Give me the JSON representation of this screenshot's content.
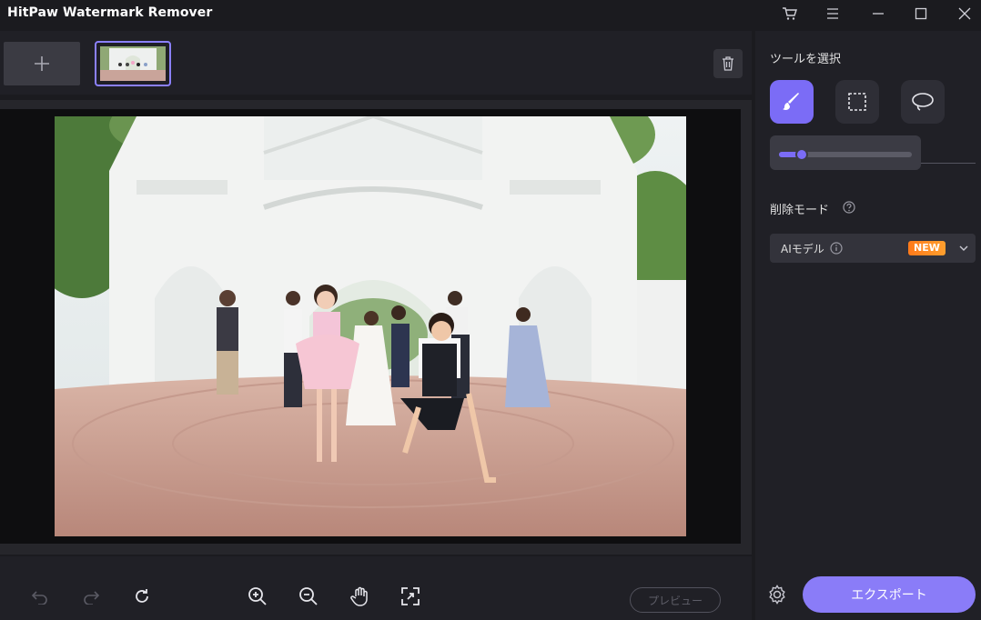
{
  "app": {
    "title": "HitPaw Watermark Remover"
  },
  "titlebar": {
    "icons": [
      "cart-icon",
      "menu-icon",
      "minimize-icon",
      "maximize-icon",
      "close-icon"
    ]
  },
  "strip": {
    "add_icon": "plus-icon",
    "trash_icon": "trash-icon"
  },
  "panel": {
    "tool_section_title": "ツールを選択",
    "tools": [
      "brush-icon",
      "rect-select-icon",
      "lasso-icon"
    ],
    "active_tool": "brush",
    "brush_size": 0.17,
    "mode_section_title": "削除モード",
    "mode_value": "AIモデル",
    "new_badge": "NEW",
    "export_label": "エクスポート"
  },
  "bottom": {
    "preview_label": "プレビュー",
    "tools": [
      "undo-icon",
      "redo-icon",
      "reset-icon",
      "zoom-in-icon",
      "zoom-out-icon",
      "hand-icon",
      "fit-icon"
    ]
  },
  "colors": {
    "accent": "#7b6cf6",
    "badge": "#ff8a1e",
    "bg": "#1b1b1f",
    "panel": "#202026"
  }
}
